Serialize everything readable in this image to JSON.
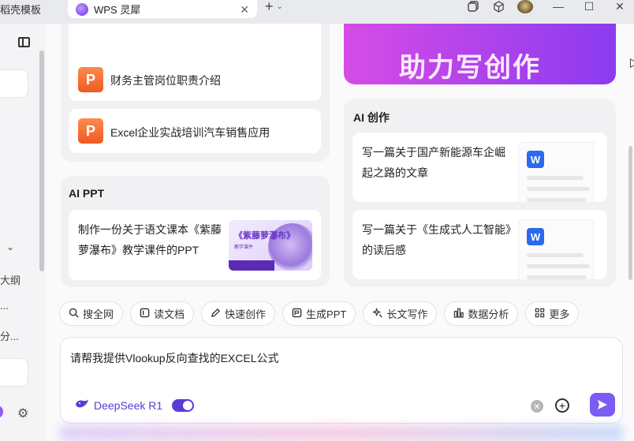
{
  "titlebar": {
    "prev_tab_label": "稻壳模板",
    "active_tab_label": "WPS 灵犀",
    "close_glyph": "✕",
    "new_tab_glyph": "+",
    "minimize_glyph": "—",
    "maximize_glyph": "☐",
    "close_window_glyph": "✕"
  },
  "sidebar": {
    "text_outline": "大纲",
    "text_dots": "...",
    "text_fen": "分..."
  },
  "left_panel": {
    "items": [
      {
        "label": "财务主管岗位职责介绍",
        "icon": "P"
      },
      {
        "label": "Excel企业实战培训汽车销售应用",
        "icon": "P"
      }
    ]
  },
  "banner": {
    "text": "助力写创作"
  },
  "ai_ppt": {
    "title": "AI PPT",
    "card_text": "制作一份关于语文课本《紫藤萝瀑布》教学课件的PPT",
    "thumb_title": "《紫藤萝瀑布》",
    "thumb_sub": "教学课件"
  },
  "ai_creation": {
    "title": "AI 创作",
    "cards": [
      {
        "text": "写一篇关于国产新能源车企崛起之路的文章",
        "icon": "W"
      },
      {
        "text": "写一篇关于《生成式人工智能》的读后感",
        "icon": "W"
      }
    ]
  },
  "chips": [
    {
      "label": "搜全网",
      "icon": "search-icon"
    },
    {
      "label": "读文档",
      "icon": "read-doc-icon"
    },
    {
      "label": "快速创作",
      "icon": "pen-icon"
    },
    {
      "label": "生成PPT",
      "icon": "ppt-icon"
    },
    {
      "label": "长文写作",
      "icon": "sparkle-icon"
    },
    {
      "label": "数据分析",
      "icon": "chart-icon"
    },
    {
      "label": "更多",
      "icon": "grid-icon"
    }
  ],
  "input": {
    "value": "请帮我提供Vlookup反向查找的EXCEL公式",
    "model_label": "DeepSeek R1"
  },
  "colors": {
    "accent": "#5b3bd6",
    "send_button": "#7b5cf5",
    "ppt_orange": "#ee5a24",
    "word_blue": "#2b6af0"
  }
}
